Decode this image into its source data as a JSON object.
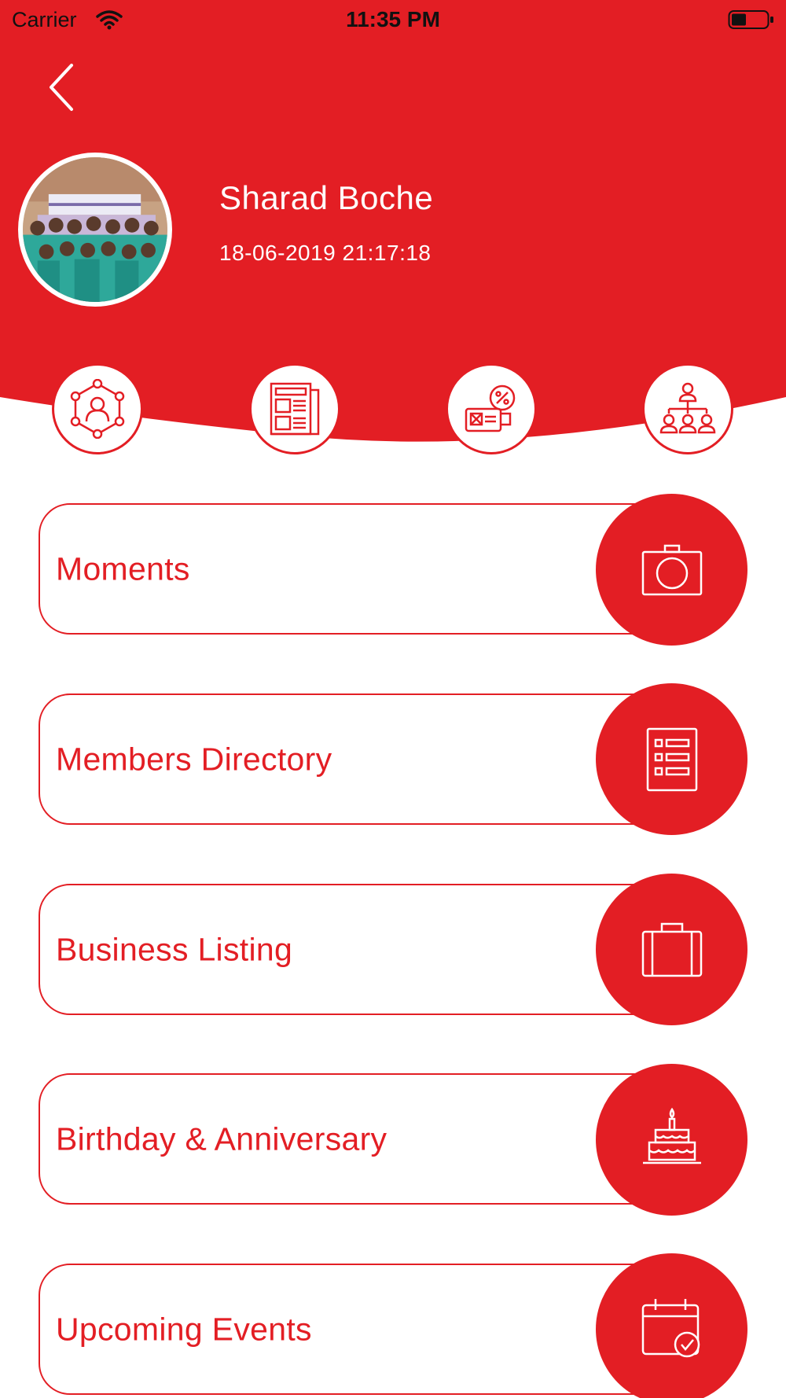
{
  "status_bar": {
    "carrier": "Carrier",
    "time": "11:35 PM"
  },
  "profile": {
    "name": "Sharad Boche",
    "timestamp": "18-06-2019 21:17:18"
  },
  "quick_actions": [
    {
      "icon": "network-people-icon"
    },
    {
      "icon": "newspaper-icon"
    },
    {
      "icon": "offers-discount-icon"
    },
    {
      "icon": "organization-chart-icon"
    }
  ],
  "menu": [
    {
      "label": "Moments",
      "icon": "camera-icon"
    },
    {
      "label": "Members Directory",
      "icon": "directory-list-icon"
    },
    {
      "label": "Business Listing",
      "icon": "briefcase-icon"
    },
    {
      "label": "Birthday & Anniversary",
      "icon": "birthday-cake-icon"
    },
    {
      "label": "Upcoming Events",
      "icon": "calendar-check-icon"
    }
  ],
  "colors": {
    "primary": "#e31e24",
    "background": "#ffffff",
    "text_on_primary": "#ffffff"
  }
}
